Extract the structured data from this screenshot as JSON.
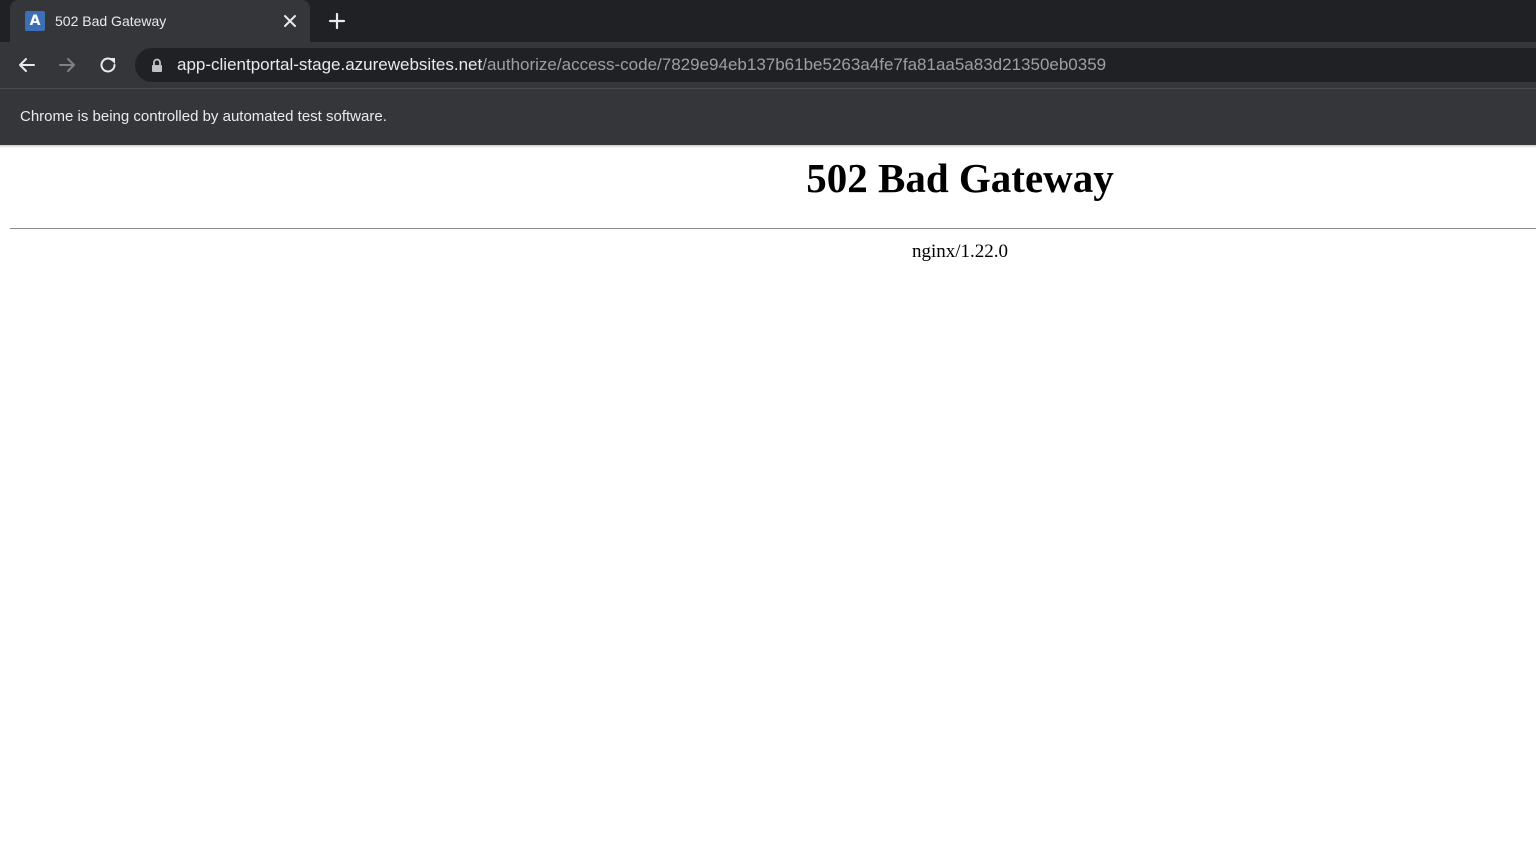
{
  "browser": {
    "tab": {
      "favicon_letter": "A",
      "title": "502 Bad Gateway"
    },
    "toolbar": {
      "url_host": "app-clientportal-stage.azurewebsites.net",
      "url_path": "/authorize/access-code/7829e94eb137b61be5263a4fe7fa81aa5a83d21350eb0359"
    },
    "infobar": {
      "message": "Chrome is being controlled by automated test software."
    },
    "icons": {
      "close": "close-icon",
      "new_tab": "plus-icon",
      "back": "arrow-left-icon",
      "forward": "arrow-right-icon",
      "reload": "reload-icon",
      "lock": "lock-icon"
    },
    "colors": {
      "tabstrip": "#202124",
      "toolbar": "#35363a",
      "omnibox": "#202124",
      "favicon": "#3d6fb6"
    }
  },
  "page": {
    "heading": "502 Bad Gateway",
    "server_signature": "nginx/1.22.0"
  }
}
